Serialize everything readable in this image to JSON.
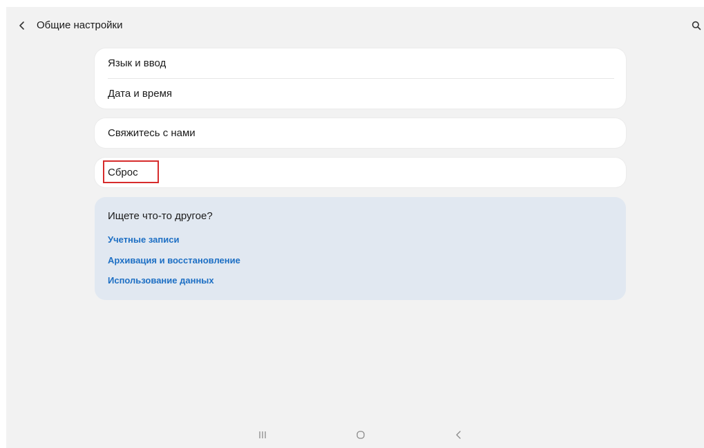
{
  "header": {
    "title": "Общие настройки",
    "back_icon": "chevron-left-icon",
    "search_icon": "search-icon"
  },
  "settings_groups": [
    {
      "items": [
        {
          "label": "Язык и ввод"
        },
        {
          "label": "Дата и время"
        }
      ]
    },
    {
      "items": [
        {
          "label": "Свяжитесь с нами"
        }
      ]
    },
    {
      "items": [
        {
          "label": "Сброс",
          "highlighted": true
        }
      ]
    }
  ],
  "suggestions": {
    "title": "Ищете что-то другое?",
    "links": [
      {
        "label": "Учетные записи"
      },
      {
        "label": "Архивация и восстановление"
      },
      {
        "label": "Использование данных"
      }
    ]
  },
  "navigation_bar": {
    "buttons": [
      {
        "icon": "recents-icon"
      },
      {
        "icon": "home-icon"
      },
      {
        "icon": "back-icon"
      }
    ]
  },
  "colors": {
    "background": "#f2f2f2",
    "card": "#ffffff",
    "suggestion_panel": "#e1e8f1",
    "link": "#1d6fc4",
    "highlight": "#d62b2b"
  }
}
